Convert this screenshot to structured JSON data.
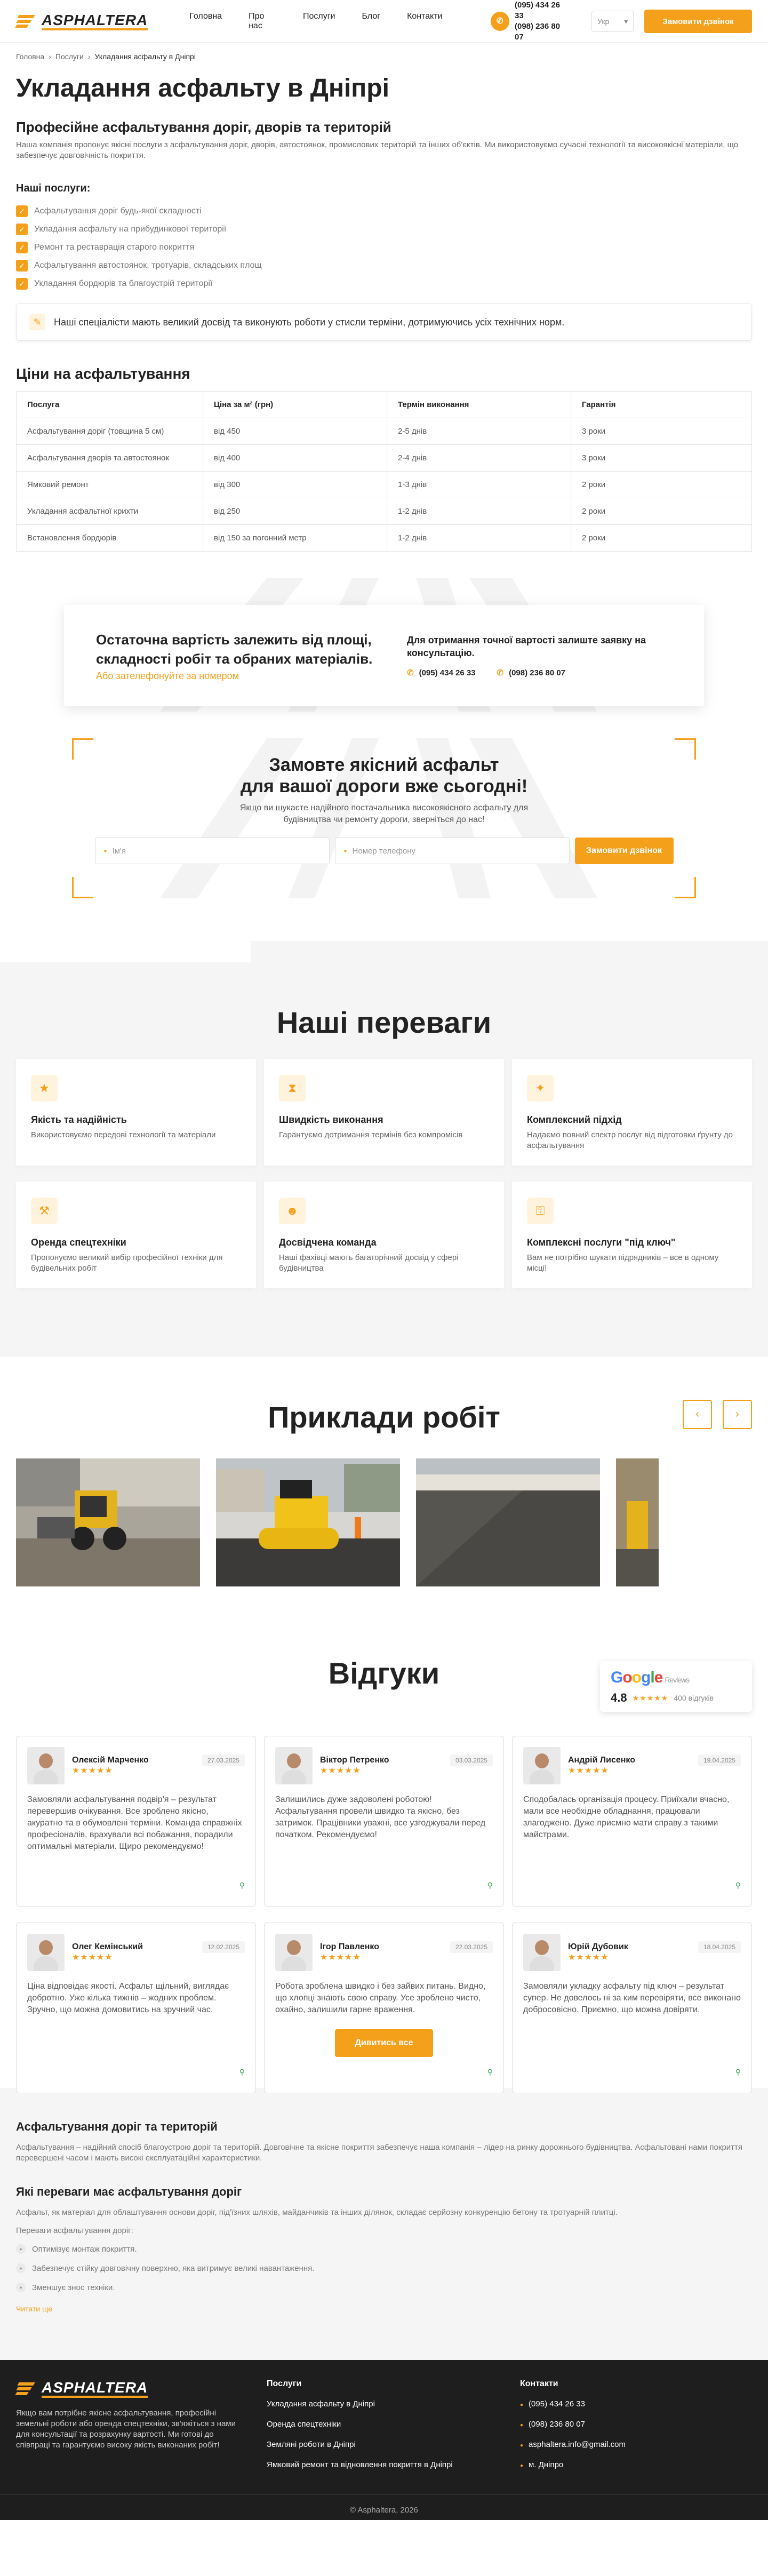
{
  "header": {
    "logo": "ASPHALTERA",
    "nav": [
      "Головна",
      "Про нас",
      "Послуги",
      "Блог",
      "Контакти"
    ],
    "phone1": "(095) 434 26 33",
    "phone2": "(098) 236 80 07",
    "lang": "Укр",
    "cta": "Замовити дзвінок"
  },
  "breadcrumbs": [
    "Головна",
    "Послуги",
    "Укладання асфальту в Дніпрі"
  ],
  "page": {
    "title": "Укладання асфальту в Дніпрі",
    "subtitle": "Професійне асфальтування доріг, дворів та територій",
    "intro": "Наша компанія пропонує якісні послуги з асфальтування доріг, дворів, автостоянок, промислових територій та інших об'єктів. Ми використовуємо сучасні технології та високоякісні матеріали, що забезпечує довговічність покриття.",
    "services_title": "Наші послуги:",
    "services": [
      "Асфальтування доріг будь-якої складності",
      "Укладання асфальту на прибудинкової території",
      "Ремонт та реставрація старого покриття",
      "Асфальтування автостоянок, тротуарів, складських площ",
      "Укладання бордюрів та благоустрій території"
    ],
    "note": "Наші спеціалісти мають великий досвід та виконують роботи у стисли терміни, дотримуючись усіх технічних норм."
  },
  "prices": {
    "title": "Ціни на асфальтування",
    "headers": [
      "Послуга",
      "Ціна за м² (грн)",
      "Термін виконання",
      "Гарантія"
    ],
    "rows": [
      [
        "Асфальтування доріг (товщина 5 см)",
        "від 450",
        "2-5 днів",
        "3 роки"
      ],
      [
        "Асфальтування дворів та автостоянок",
        "від 400",
        "2-4 днів",
        "3 роки"
      ],
      [
        "Ямковий ремонт",
        "від 300",
        "1-3 днів",
        "2 роки"
      ],
      [
        "Укладання асфальтної крихти",
        "від 250",
        "1-2 днів",
        "2 роки"
      ],
      [
        "Встановлення бордюрів",
        "від 150 за погонний метр",
        "1-2 днів",
        "2 роки"
      ]
    ]
  },
  "cta1": {
    "text": "Остаточна вартість залежить від площі, складності робіт та обраних матеріалів.",
    "link": "Або зателефонуйте за номером",
    "right": "Для отримання точної вартості залиште заявку на консультацію.",
    "phone1": "(095) 434 26 33",
    "phone2": "(098) 236 80 07"
  },
  "form": {
    "title1": "Замовте якісний асфальт",
    "title2": "для вашої дороги вже сьогодні!",
    "text": "Якщо ви шукаєте надійного постачальника високоякісного асфальту для будівництва чи ремонту дороги, зверніться до нас!",
    "name_ph": "Ім'я",
    "phone_ph": "Номер телефону",
    "btn": "Замовити дзвінок"
  },
  "advantages": {
    "title": "Наші переваги",
    "items": [
      {
        "t": "Якість та надійність",
        "d": "Використовуємо передові технології та матеріали"
      },
      {
        "t": "Швидкість виконання",
        "d": "Гарантуємо дотримання термінів без компромісів"
      },
      {
        "t": "Комплексний підхід",
        "d": "Надаємо повний спектр послуг від підготовки ґрунту до асфальтування"
      },
      {
        "t": "Оренда спецтехніки",
        "d": "Пропонуємо великий вибір професійної техніки для будівельних робіт"
      },
      {
        "t": "Досвідчена команда",
        "d": "Наші фахівці мають багаторічний досвід у сфері будівництва"
      },
      {
        "t": "Комплексні послуги \"під ключ\"",
        "d": "Вам не потрібно шукати підрядників – все в одному місці!"
      }
    ]
  },
  "examples": {
    "title": "Приклади робіт",
    "prev": "‹",
    "next": "›"
  },
  "reviews": {
    "title": "Відгуки",
    "google_label": "Reviews",
    "rating": "4.8",
    "stars": "★★★★★",
    "count": "400 відгуків",
    "items": [
      {
        "n": "Олексій Марченко",
        "d": "27.03.2025",
        "t": "Замовляли асфальтування подвір'я – результат перевершив очікування. Все зроблено якісно, акуратно та в обумовлені терміни. Команда справжніх професіоналів, врахували всі побажання, порадили оптимальні матеріали. Щиро рекомендуємо!"
      },
      {
        "n": "Віктор Петренко",
        "d": "03.03.2025",
        "t": "Залишились дуже задоволені роботою! Асфальтування провели швидко та якісно, без затримок. Працівники уважні, все узгоджували перед початком. Рекомендуємо!"
      },
      {
        "n": "Андрій Лисенко",
        "d": "19.04.2025",
        "t": "Сподобалась організація процесу. Приїхали вчасно, мали все необхідне обладнання, працювали злагоджено. Дуже приємно мати справу з такими майстрами."
      },
      {
        "n": "Олег Кемінський",
        "d": "12.02.2025",
        "t": "Ціна відповідає якості. Асфальт щільний, виглядає добротно. Уже кілька тижнів – жодних проблем. Зручно, що можна домовитись на зручний час."
      },
      {
        "n": "Ігор Павленко",
        "d": "22.03.2025",
        "t": "Робота зроблена швидко і без зайвих питань. Видно, що хлопці знають свою справу. Усе зроблено чисто, охайно, залишили гарне враження."
      },
      {
        "n": "Юрій Дубовик",
        "d": "18.04.2025",
        "t": "Замовляли укладку асфальту під ключ – результат супер. Не довелось ні за ким перевіряти, все виконано добросовісно. Приємно, що можна довіряти."
      }
    ],
    "all": "Дивитись все"
  },
  "seo": {
    "h1": "Асфальтування доріг та територій",
    "p1": "Асфальтування – надійний спосіб благоустрою доріг та територій. Довговічне та якісне покриття забезпечує наша компанія – лідер на ринку дорожнього будівництва. Асфальтовані нами покриття перевершені часом і мають високі експлуатаційні характеристики.",
    "h2": "Які переваги має асфальтування доріг",
    "p2": "Асфальт, як матеріал для облаштування основи доріг, під'їзних шляхів, майданчиків та інших ділянок, складає серйозну конкуренцію бетону та тротуарній плитці.",
    "p3": "Переваги асфальтування доріг:",
    "list": [
      "Оптимізує монтаж покриття.",
      "Забезпечує стійку довговічну поверхню, яка витримує великі навантаження.",
      "Зменшує знос техніки."
    ],
    "more": "Читати ще"
  },
  "footer": {
    "logo": "ASPHALTERA",
    "about": "Якщо вам потрібне якісне асфальтування, професійні земельні роботи або оренда спецтехніки, зв'яжіться з нами для консультації та розрахунку вартості. Ми готові до співпраці та гарантуємо високу якість виконаних робіт!",
    "services_title": "Послуги",
    "services": [
      "Укладання асфальту в Дніпрі",
      "Оренда спецтехніки",
      "Земляні роботи в Дніпрі",
      "Ямковий ремонт та відновлення покриття в Дніпрі"
    ],
    "contacts_title": "Контакти",
    "contacts": [
      "(095) 434 26 33",
      "(098) 236 80 07",
      "asphaltera.info@gmail.com",
      "м. Дніпро"
    ],
    "copy": "© Asphaltera, 2026"
  }
}
